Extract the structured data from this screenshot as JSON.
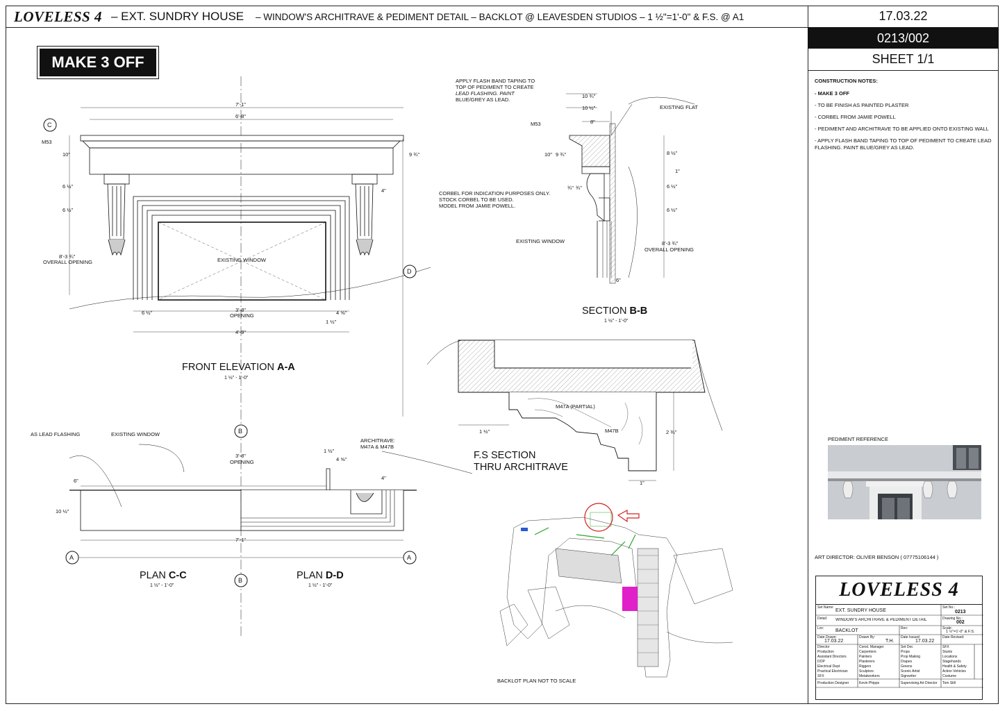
{
  "header": {
    "production": "LOVELESS 4",
    "set_title": "– EXT. SUNDRY HOUSE",
    "subtitle": "– WINDOW'S ARCHITRAVE & PEDIMENT DETAIL – BACKLOT @ LEAVESDEN STUDIOS – 1 ½\"=1'-0\" & F.S. @ A1",
    "date": "17.03.22",
    "drawing_number": "0213/002",
    "sheet": "SHEET 1/1"
  },
  "make_3_off": "MAKE 3 OFF",
  "notes": {
    "title": "CONSTRUCTION NOTES:",
    "items": [
      "- MAKE 3 OFF",
      "- TO BE FINISH AS PAINTED PLASTER",
      "- CORBEL FROM JAMIE POWELL",
      "- PEDIMENT AND ARCHITRAVE TO BE APPLIED ONTO EXISTING WALL",
      "- APPLY FLASH BAND TAPING TO TOP OF PEDIMENT TO CREATE LEAD FLASHING. PAINT BLUE/GREY AS LEAD."
    ]
  },
  "pediment_reference": "PEDIMENT REFERENCE",
  "art_director": "ART DIRECTOR: OLIVER BENSON ( 07775106144 )",
  "views": {
    "front_title": "FRONT ELEVATION",
    "front_tag": "A-A",
    "front_scale": "1 ½\" - 1'-0\"",
    "section_title": "SECTION",
    "section_tag": "B-B",
    "section_scale": "1 ½\" - 1'-0\"",
    "plan_c_title": "PLAN",
    "plan_c_tag": "C-C",
    "plan_c_scale": "1 ½\" - 1'-0\"",
    "plan_d_title": "PLAN",
    "plan_d_tag": "D-D",
    "plan_d_scale": "1 ½\" - 1'-0\"",
    "fs_title_1": "F.S SECTION",
    "fs_title_2": "THRU ARCHITRAVE",
    "backlot_caption": "BACKLOT PLAN NOT TO SCALE"
  },
  "markers": {
    "a": "A",
    "b": "B",
    "c": "C",
    "d": "D"
  },
  "labels": {
    "m53": "M53",
    "existing_window": "EXISTING WINDOW",
    "overall_opening": "OVERALL OPENING",
    "opening": "OPENING",
    "flash_note_1": "APPLY FLASH BAND TAPING TO",
    "flash_note_2": "TOP OF PEDIMENT TO CREATE",
    "flash_note_3": "LEAD FLASHING. PAINT",
    "flash_note_4": "BLUE/GREY AS LEAD.",
    "existing_flat": "EXISTING FLAT",
    "corbel_1": "CORBEL FOR INDICATION PURPOSES ONLY.",
    "corbel_2": "STOCK CORBEL TO BE USED.",
    "corbel_3": "MODEL FROM JAMIE POWELL.",
    "as_lead_flashing": "AS LEAD FLASHING",
    "architrave_1": "ARCHITRAVE:",
    "architrave_2": "M47A & M47B",
    "m47a": "M47A (PARTIAL)",
    "m47b": "M47B"
  },
  "dims": {
    "w_7_1": "7'-1\"",
    "w_6_8": "6'-8\"",
    "d10": "10\"",
    "d9_3_4": "9 ¾\"",
    "d6_half": "6 ½\"",
    "d4": "4\"",
    "d8_3_3_4": "8'-3 ¾\"",
    "d3_8": "3'-8\"",
    "d4_5_8": "4 ⅝\"",
    "d1_half": "1 ½\"",
    "d4_9": "4'-9\"",
    "d10_3_4": "10 ¾\"",
    "d8": "8\"",
    "d8_half": "8 ½\"",
    "d1": "1\"",
    "d6": "6\"",
    "d3_4": "¾\"",
    "d2_3_4": "2 ¾\"",
    "d10_half": "10 ½\""
  },
  "titleblock": {
    "logo": "LOVELESS 4",
    "set_name_label": "Set Name:",
    "set_name": "EXT. SUNDRY HOUSE",
    "set_no_label": "Set No.:",
    "set_no": "0213",
    "detail_label": "Detail:",
    "detail": "WINDOW'S ARCHITRAVE & PEDIMENT DETAIL",
    "drawing_no_label": "Drawing No.:",
    "drawing_no": "002",
    "loc_label": "Loc:",
    "loc": "BACKLOT",
    "rev_label": "Rev:",
    "scale_label": "Scale:",
    "scale": "1 ½\"=1'-0\" & F.S.",
    "date_drawn_label": "Date Drawn:",
    "date_drawn": "17.03.22",
    "drawn_by_label": "Drawn By:",
    "drawn_by": "T.H.",
    "date_issued_label": "Date Issued:",
    "date_issued": "17.03.22",
    "date_revised_label": "Date Revised:",
    "dist_col1": [
      "Director",
      "Production",
      "Assistant Directors",
      "DOP",
      "Electrical Dept",
      "Practical Electrician",
      "SFX"
    ],
    "dist_col2": [
      "Const. Manager",
      "Carpenters",
      "Painters",
      "Plasterers",
      "Riggers",
      "Sculptors",
      "Metalworkers"
    ],
    "dist_col3": [
      "Set Dec",
      "Props",
      "Prop Making",
      "Drapes",
      "Greens",
      "Scenic Artist",
      "Signwriter"
    ],
    "dist_col4": [
      "SFX",
      "Stunts",
      "Locations",
      "Stagehands",
      "Health & Safety",
      "Action Vehicles",
      "Costume"
    ],
    "designer_label": "Production Designer",
    "designer": "Kevin Phipps",
    "sad_label": "Supervising Art Director",
    "sad": "Tom Still"
  },
  "colors": {
    "ink": "#111111",
    "highlight": "#d42020",
    "magenta": "#e020c8",
    "green": "#2aa52a"
  }
}
